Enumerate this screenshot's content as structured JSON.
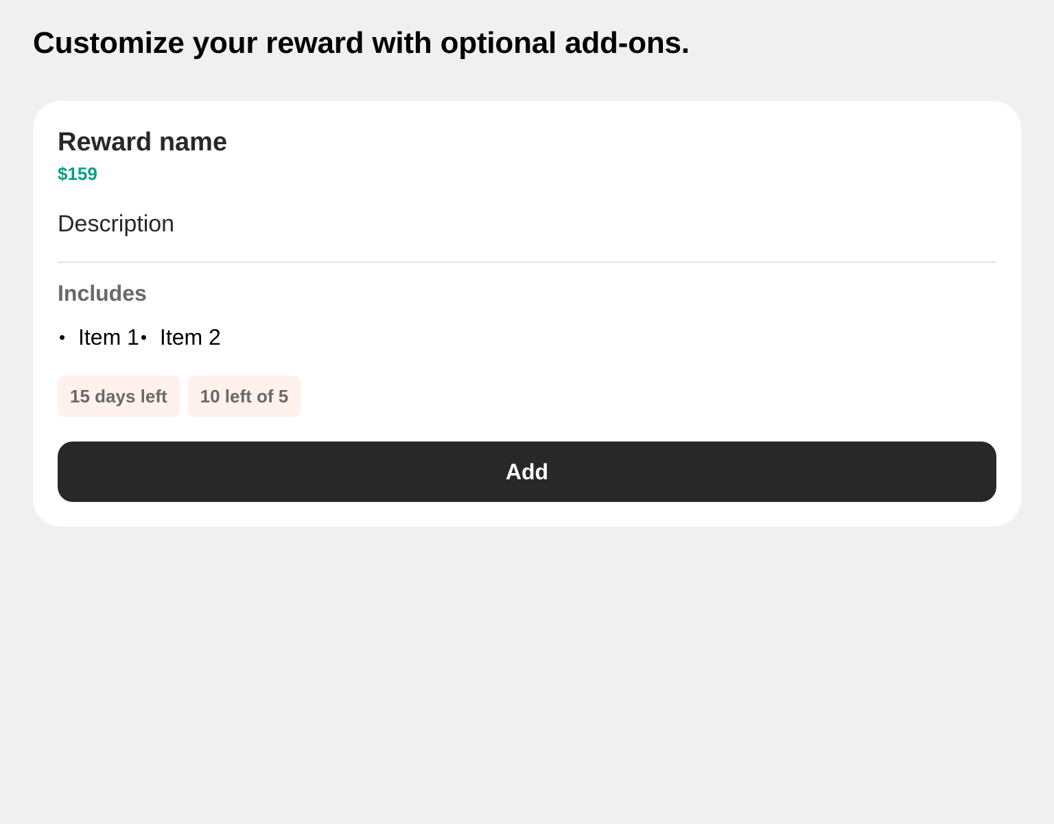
{
  "page": {
    "heading": "Customize your reward with optional add-ons."
  },
  "reward": {
    "name": "Reward name",
    "price": "$159",
    "description": "Description",
    "includes_label": "Includes",
    "includes": [
      {
        "label": "Item 1"
      },
      {
        "label": "Item 2"
      }
    ],
    "tags": [
      {
        "label": "15 days left"
      },
      {
        "label": "10 left of 5"
      }
    ],
    "add_button_label": "Add"
  },
  "colors": {
    "background": "#f0f0f0",
    "card": "#ffffff",
    "price_accent": "#05a081",
    "tag_background": "#fff1ec",
    "button_background": "#282828",
    "button_text": "#ffffff"
  },
  "icons": {
    "list_bullet": "bullet-icon"
  }
}
